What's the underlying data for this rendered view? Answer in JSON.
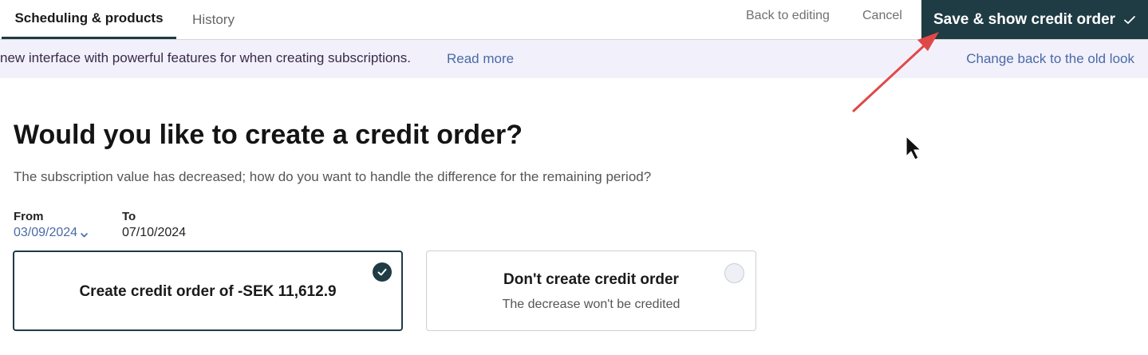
{
  "tabs": {
    "scheduling": "Scheduling & products",
    "history": "History"
  },
  "toolbar": {
    "back_label": "Back to editing",
    "cancel_label": "Cancel",
    "save_label": "Save & show credit order"
  },
  "banner": {
    "text": "new interface with powerful features for when creating subscriptions.",
    "read_more": "Read more",
    "old_look": "Change back to the old look"
  },
  "content": {
    "title": "Would you like to create a credit order?",
    "subtitle": "The subscription value has decreased; how do you want to handle the difference for the remaining period?",
    "from_label": "From",
    "from_value": "03/09/2024",
    "to_label": "To",
    "to_value": "07/10/2024"
  },
  "options": {
    "create": {
      "title": "Create credit order of -SEK 11,612.9",
      "selected": true
    },
    "no_create": {
      "title": "Don't create credit order",
      "description": "The decrease won't be credited",
      "selected": false
    }
  },
  "colors": {
    "primary_dark": "#1f3b44",
    "link_blue": "#4a6aa6",
    "banner_bg": "#f1f0fb",
    "annotation_red": "#e04848"
  },
  "icons": {
    "save_check": "checkmark-icon",
    "from_chevron": "chevron-down-icon",
    "selected_radio": "checkmark-circle-icon",
    "annotation": "red-arrow-icon",
    "cursor": "mouse-pointer-icon"
  }
}
